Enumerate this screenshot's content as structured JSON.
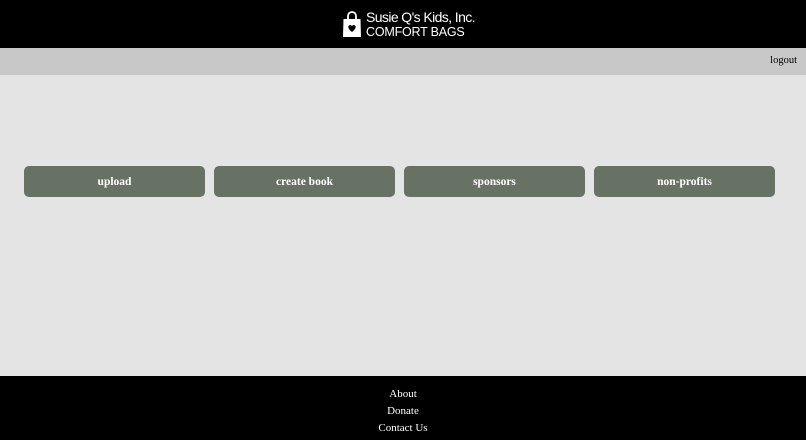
{
  "header": {
    "brand_line1": "Susie Q's Kids, Inc.",
    "brand_line2": "COMFORT BAGS",
    "logo_icon": "shopping-bag-heart-icon"
  },
  "topbar": {
    "logout_label": "logout"
  },
  "actions": [
    {
      "label": "upload"
    },
    {
      "label": "create book"
    },
    {
      "label": "sponsors"
    },
    {
      "label": "non-profits"
    }
  ],
  "footer": {
    "links": [
      {
        "label": "About"
      },
      {
        "label": "Donate"
      },
      {
        "label": "Contact Us"
      }
    ]
  },
  "colors": {
    "header_bg": "#000000",
    "topbar_bg": "#c8c8c8",
    "page_bg": "#e4e4e4",
    "button_bg": "#677264",
    "button_text": "#ffffff"
  }
}
